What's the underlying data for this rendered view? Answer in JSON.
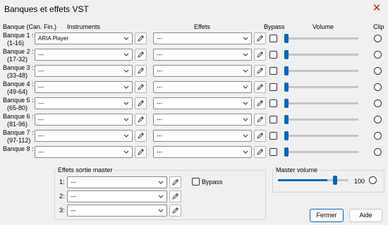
{
  "window": {
    "title": "Banques et effets VST",
    "close_glyph": "✕"
  },
  "headers": {
    "bank": "Banque (Can. Fin.)",
    "instruments": "Instruments",
    "effects": "Effets",
    "bypass": "Bypass",
    "volume": "Volume",
    "clip": "Clip"
  },
  "banks": [
    {
      "name": "Banque 1 :",
      "range": "(1-16)",
      "instrument": "ARIA Player",
      "effect": "---",
      "bypass": false,
      "volume": 0
    },
    {
      "name": "Banque 2 :",
      "range": "(17-32)",
      "instrument": "---",
      "effect": "---",
      "bypass": false,
      "volume": 0
    },
    {
      "name": "Banque 3 :",
      "range": "(33-48)",
      "instrument": "---",
      "effect": "---",
      "bypass": false,
      "volume": 0
    },
    {
      "name": "Banque 4 :",
      "range": "(49-64)",
      "instrument": "---",
      "effect": "---",
      "bypass": false,
      "volume": 0
    },
    {
      "name": "Banque 5 :",
      "range": "(65-80)",
      "instrument": "---",
      "effect": "---",
      "bypass": false,
      "volume": 0
    },
    {
      "name": "Banque 6 :",
      "range": "(81-96)",
      "instrument": "---",
      "effect": "---",
      "bypass": false,
      "volume": 0
    },
    {
      "name": "Banque 7 :",
      "range": "(97-112)",
      "instrument": "---",
      "effect": "---",
      "bypass": false,
      "volume": 0
    },
    {
      "name": "Banque 8 :",
      "range": "",
      "instrument": "---",
      "effect": "---",
      "bypass": false,
      "volume": 0
    }
  ],
  "master_effects": {
    "title": "Effets sortie master",
    "bypass_label": "Bypass",
    "bypass": false,
    "slots": [
      {
        "label": "1:",
        "value": "---"
      },
      {
        "label": "2:",
        "value": "---"
      },
      {
        "label": "3:",
        "value": "---"
      }
    ]
  },
  "master_volume": {
    "title": "Master volume",
    "value": "100",
    "level_fraction": 0.7
  },
  "buttons": {
    "close": "Fermer",
    "help": "Aide"
  },
  "colors": {
    "accent": "#0067c0",
    "close_red": "#c42b1c"
  },
  "icons": {
    "pencil": "pencil-icon",
    "dropdown": "chevron-down-icon"
  }
}
